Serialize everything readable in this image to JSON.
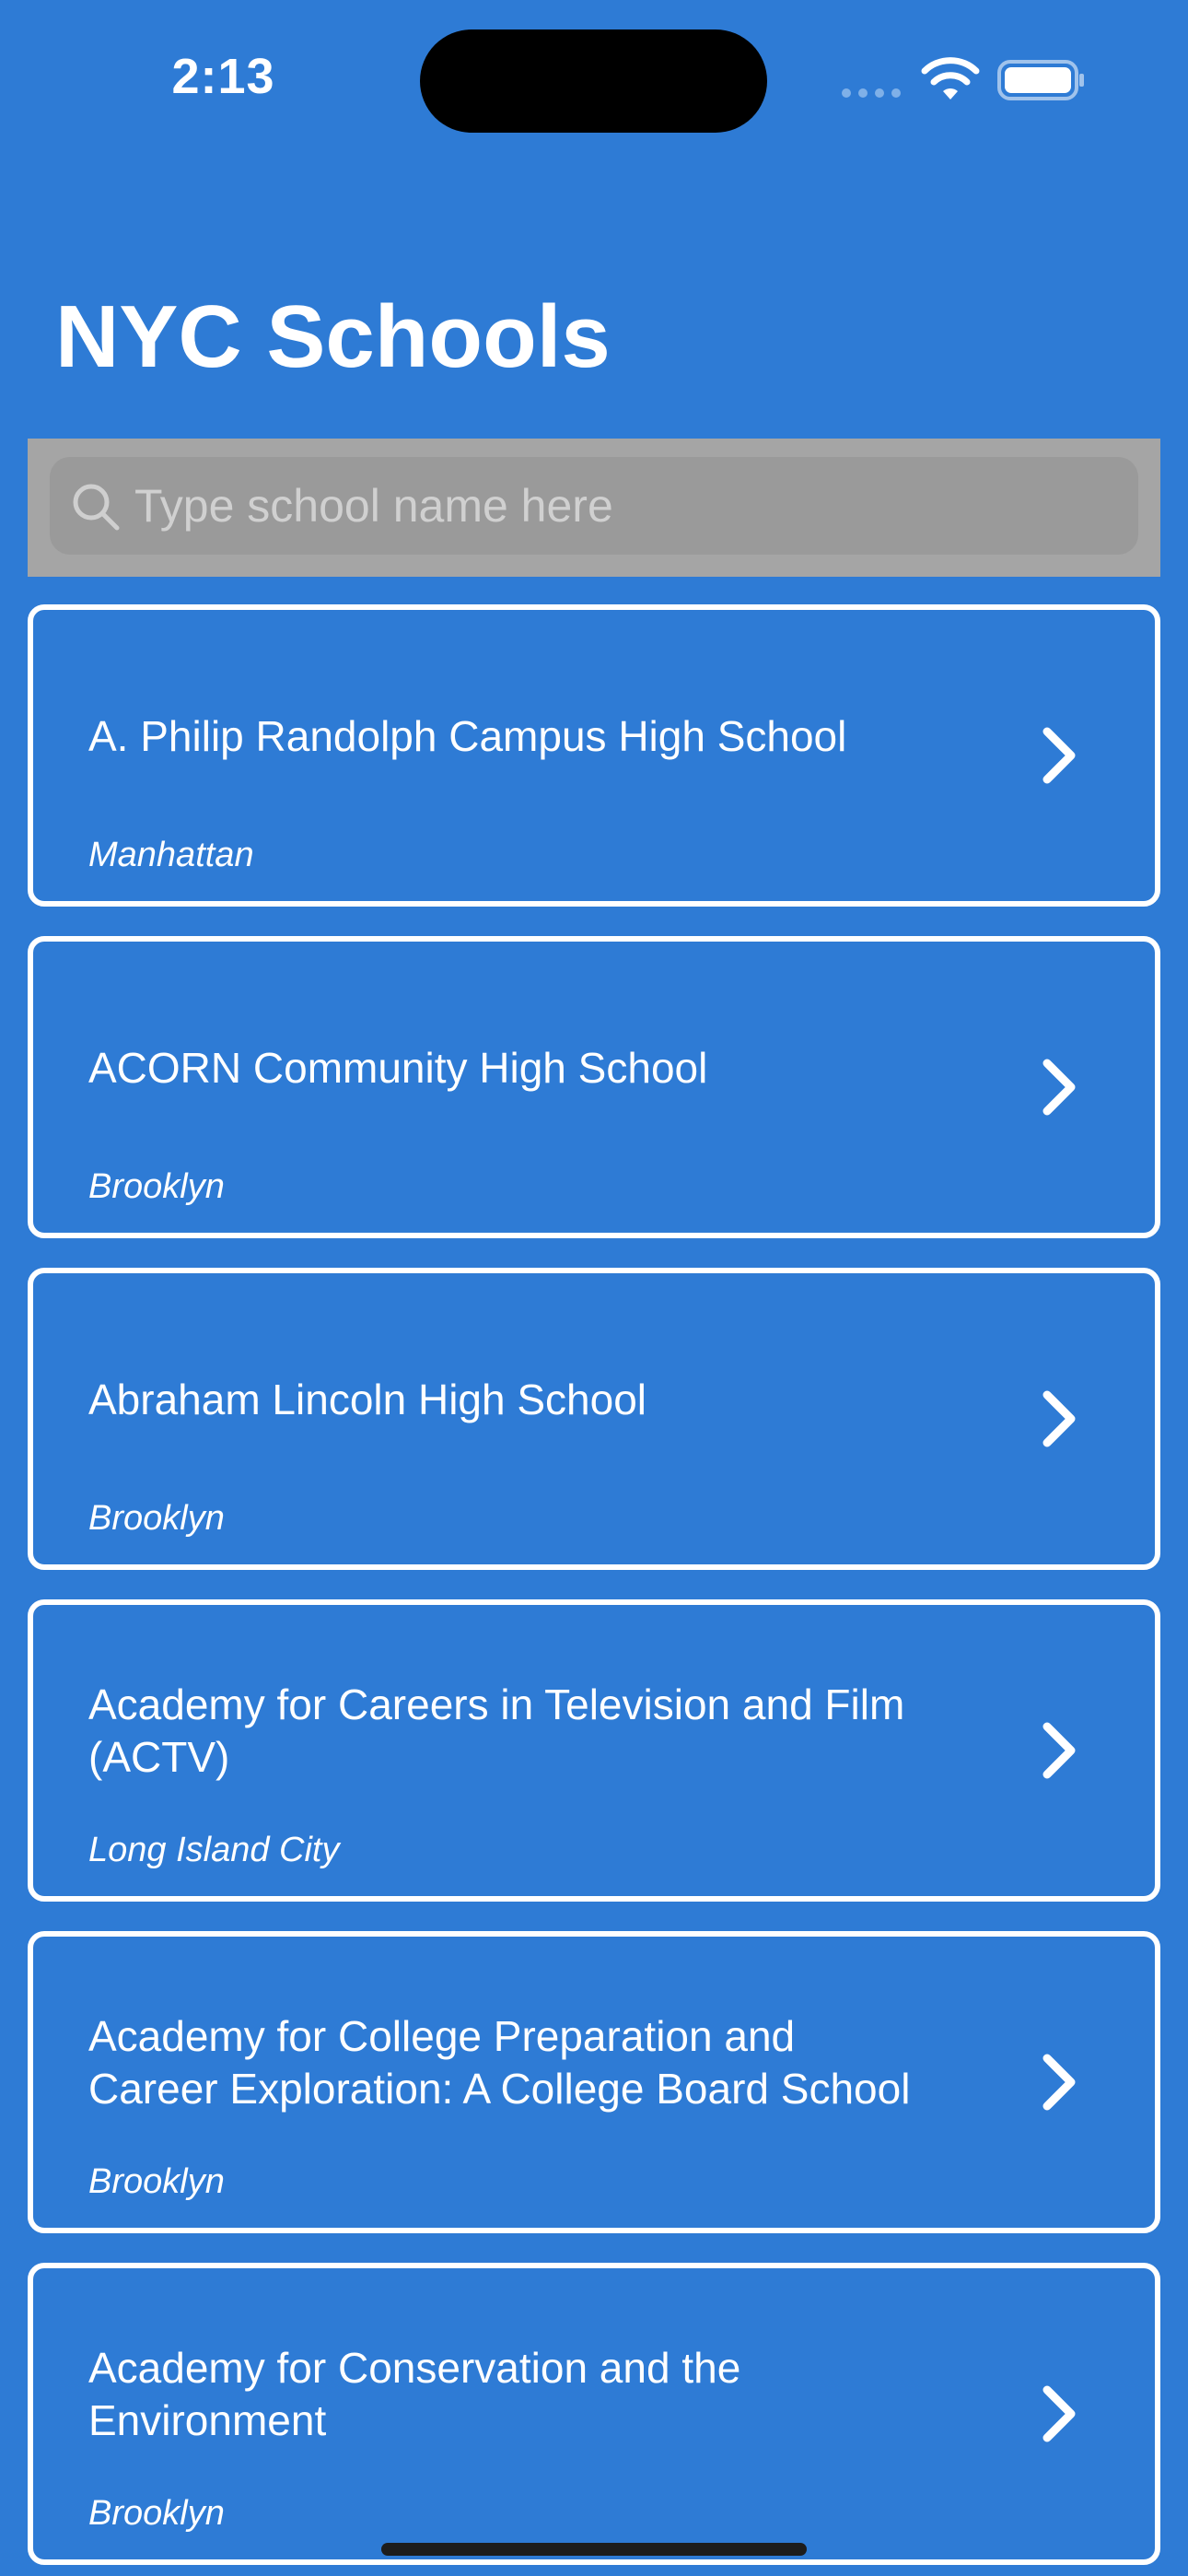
{
  "status_bar": {
    "time": "2:13"
  },
  "header": {
    "title": "NYC Schools"
  },
  "search": {
    "placeholder": "Type school name here",
    "value": ""
  },
  "schools": [
    {
      "name": "A. Philip Randolph Campus High School",
      "borough": "Manhattan"
    },
    {
      "name": "ACORN Community High School",
      "borough": "Brooklyn"
    },
    {
      "name": "Abraham Lincoln High School",
      "borough": "Brooklyn"
    },
    {
      "name": "Academy for Careers in Television and Film (ACTV)",
      "borough": "Long Island City"
    },
    {
      "name": "Academy for College Preparation and Career Exploration: A College Board School",
      "borough": "Brooklyn"
    },
    {
      "name": "Academy for Conservation and the Environment",
      "borough": "Brooklyn"
    }
  ],
  "colors": {
    "background": "#2e7bd5",
    "search_bar": "#a5a5a5",
    "card_border": "#ffffff"
  },
  "icons": {
    "search": "search-icon",
    "row_disclosure": "chevron-right-icon",
    "wifi": "wifi-icon",
    "battery": "battery-icon",
    "signal": "cellular-signal-icon"
  }
}
